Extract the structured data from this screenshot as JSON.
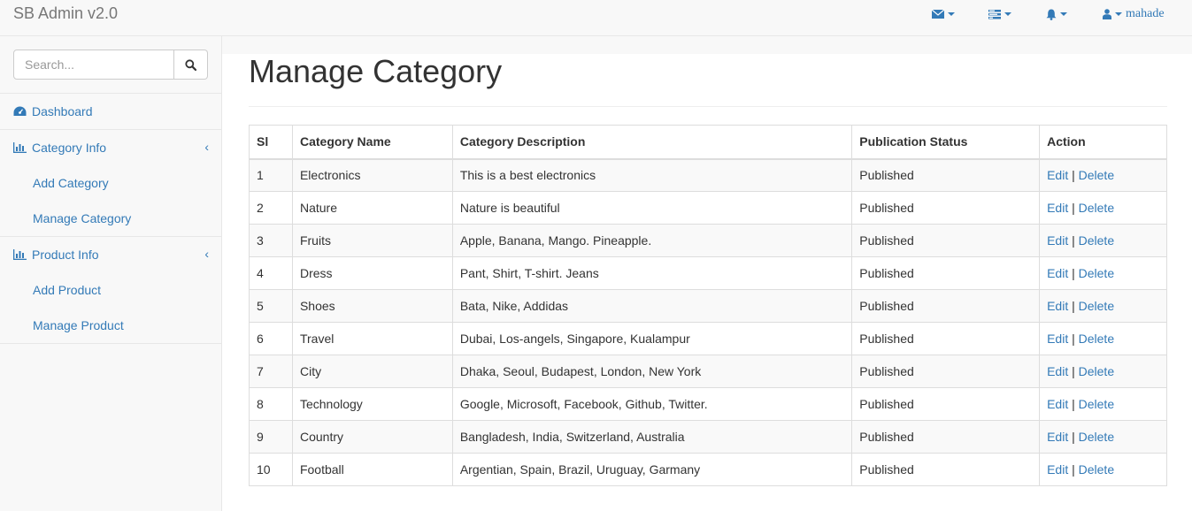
{
  "navbar": {
    "brand": "SB Admin v2.0",
    "user_name": "mahade",
    "icons": [
      "envelope-icon",
      "tasks-icon",
      "bell-icon",
      "user-icon"
    ]
  },
  "sidebar": {
    "search_placeholder": "Search...",
    "dashboard": "Dashboard",
    "category_info": "Category Info",
    "add_category": "Add Category",
    "manage_category": "Manage Category",
    "product_info": "Product Info",
    "add_product": "Add Product",
    "manage_product": "Manage Product",
    "collapse_arrow": "‹"
  },
  "main": {
    "title": "Manage Category",
    "table": {
      "headers": [
        "Sl",
        "Category Name",
        "Category Description",
        "Publication Status",
        "Action"
      ],
      "edit_label": "Edit",
      "separator": "|",
      "delete_label": "Delete",
      "rows": [
        {
          "sl": "1",
          "name": "Electronics",
          "description": "This is a best electronics",
          "status": "Published"
        },
        {
          "sl": "2",
          "name": "Nature",
          "description": "Nature is beautiful",
          "status": "Published"
        },
        {
          "sl": "3",
          "name": "Fruits",
          "description": "Apple, Banana, Mango. Pineapple.",
          "status": "Published"
        },
        {
          "sl": "4",
          "name": "Dress",
          "description": "Pant, Shirt, T-shirt. Jeans",
          "status": "Published"
        },
        {
          "sl": "5",
          "name": "Shoes",
          "description": "Bata, Nike, Addidas",
          "status": "Published"
        },
        {
          "sl": "6",
          "name": "Travel",
          "description": "Dubai, Los-angels, Singapore, Kualampur",
          "status": "Published"
        },
        {
          "sl": "7",
          "name": "City",
          "description": "Dhaka, Seoul, Budapest, London, New York",
          "status": "Published"
        },
        {
          "sl": "8",
          "name": "Technology",
          "description": "Google, Microsoft, Facebook, Github, Twitter.",
          "status": "Published"
        },
        {
          "sl": "9",
          "name": "Country",
          "description": "Bangladesh, India, Switzerland, Australia",
          "status": "Published"
        },
        {
          "sl": "10",
          "name": "Football",
          "description": "Argentian, Spain, Brazil, Uruguay, Garmany",
          "status": "Published"
        }
      ]
    }
  },
  "colors": {
    "link": "#337ab7",
    "navbar_bg": "#f8f8f8",
    "border": "#e7e7e7",
    "table_stripe": "#f9f9f9"
  }
}
